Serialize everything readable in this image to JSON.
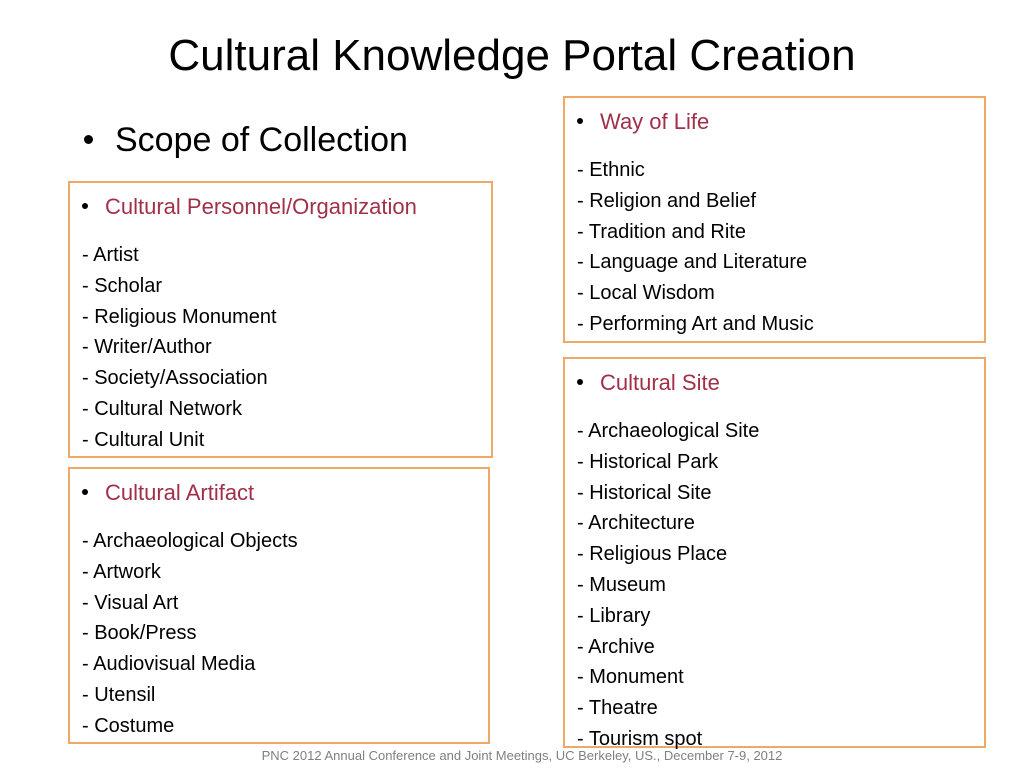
{
  "slide": {
    "title": "Cultural Knowledge Portal Creation",
    "scope_bullet": "Scope of Collection",
    "footer": "PNC 2012 Annual Conference and Joint Meetings, UC Berkeley, US., December 7-9, 2012"
  },
  "colors": {
    "box_border": "#F0A868",
    "heading_text": "#A0304A",
    "footer_text": "#808080"
  },
  "boxes": {
    "personnel": {
      "heading": "Cultural Personnel/Organization",
      "items": [
        "- Artist",
        "- Scholar",
        "- Religious Monument",
        "- Writer/Author",
        "- Society/Association",
        "- Cultural Network",
        "- Cultural Unit"
      ]
    },
    "artifact": {
      "heading": "Cultural Artifact",
      "items": [
        "- Archaeological Objects",
        "- Artwork",
        "- Visual Art",
        "- Book/Press",
        "- Audiovisual Media",
        "- Utensil",
        "- Costume"
      ]
    },
    "way_of_life": {
      "heading": "Way of Life",
      "items": [
        "- Ethnic",
        "- Religion and Belief",
        "- Tradition and Rite",
        "- Language and Literature",
        "- Local Wisdom",
        "- Performing Art and Music"
      ]
    },
    "site": {
      "heading": "Cultural Site",
      "items": [
        "- Archaeological Site",
        "- Historical Park",
        "- Historical Site",
        "- Architecture",
        "- Religious Place",
        "- Museum",
        "- Library",
        "- Archive",
        "- Monument",
        "- Theatre",
        "- Tourism spot"
      ]
    }
  }
}
